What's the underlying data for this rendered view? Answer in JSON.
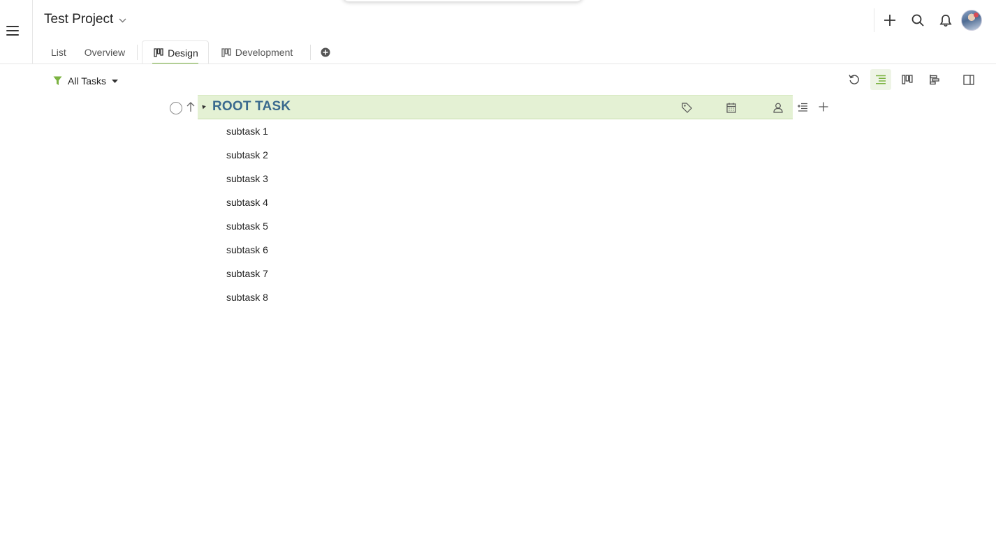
{
  "project": {
    "title": "Test Project"
  },
  "tabs": [
    {
      "label": "List",
      "active": false
    },
    {
      "label": "Overview",
      "active": false
    },
    {
      "label": "Design",
      "active": true,
      "icon": "board-icon"
    },
    {
      "label": "Development",
      "active": false,
      "icon": "board-icon"
    }
  ],
  "toolbar": {
    "filter_label": "All Tasks"
  },
  "root_task": {
    "title": "ROOT TASK"
  },
  "subtasks": [
    "subtask 1",
    "subtask 2",
    "subtask 3",
    "subtask 4",
    "subtask 5",
    "subtask 6",
    "subtask 7",
    "subtask 8"
  ],
  "colors": {
    "accent": "#7cb342",
    "root_bg": "#e4f1d4",
    "root_title": "#3a6a8e"
  }
}
